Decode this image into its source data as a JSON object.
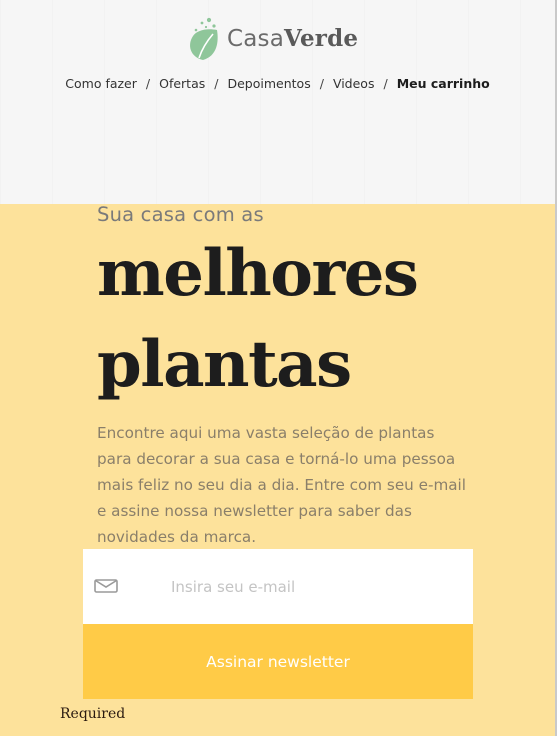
{
  "brand": {
    "name_light": "Casa",
    "name_bold": "Verde",
    "leaf_color": "#8fc69a"
  },
  "nav": {
    "items": [
      {
        "label": "Como fazer"
      },
      {
        "label": "Ofertas"
      },
      {
        "label": "Depoimentos"
      },
      {
        "label": "Videos"
      },
      {
        "label": "Meu carrinho",
        "active": true
      }
    ],
    "separator": "/"
  },
  "hero": {
    "subtitle": "Sua casa com as",
    "title_line1": "melhores",
    "title_line2": "plantas",
    "description": "Encontre aqui uma vasta seleção de plantas para decorar a sua casa e torná-lo uma pessoa mais feliz no seu dia a dia. Entre com seu e-mail e assine nossa newsletter para saber das novidades da marca.",
    "background_color": "#fde29b"
  },
  "newsletter": {
    "email_placeholder": "Insira seu e-mail",
    "email_value": "",
    "icon": "envelope-icon",
    "submit_label": "Assinar newsletter",
    "button_color": "#ffcb47"
  },
  "validation": {
    "message": "Required"
  }
}
